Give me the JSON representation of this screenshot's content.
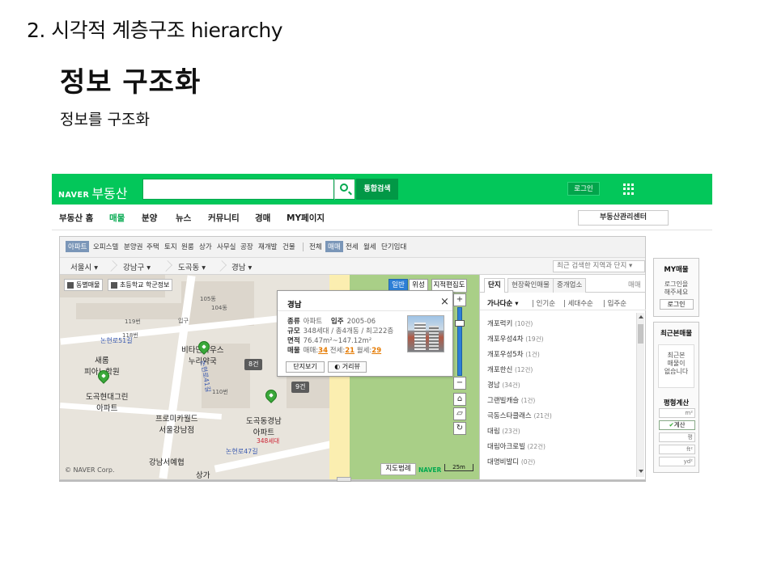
{
  "slide": {
    "heading": "2. 시각적 계층구조 hierarchy",
    "title": "정보 구조화",
    "subtitle": "정보를 구조화"
  },
  "colors": {
    "brand": "#03c75a",
    "accent_blue": "#2d7fd6",
    "highlight_orange": "#e57a00"
  },
  "topbar": {
    "logo_brand": "NAVER",
    "logo_service": "부동산",
    "search_placeholder": "",
    "search_icon": "search-icon",
    "unified_search": "통합검색",
    "login": "로그인",
    "apps_icon": "grid-icon"
  },
  "nav": {
    "items": [
      "부동산 홈",
      "매물",
      "분양",
      "뉴스",
      "커뮤니티",
      "경매",
      "MY페이지"
    ],
    "active": "매물",
    "management": "부동산관리센터"
  },
  "filters": {
    "types": [
      "아파트",
      "오피스텔",
      "분양권",
      "주택",
      "토지",
      "원룸",
      "상가",
      "사무실",
      "공장",
      "재개발",
      "건물"
    ],
    "deals": [
      "전체",
      "매매",
      "전세",
      "월세",
      "단기임대"
    ],
    "active_type": "아파트",
    "active_deal": "매매"
  },
  "location": {
    "crumbs": [
      "서울시",
      "강남구",
      "도곡동",
      "경남"
    ],
    "recent_placeholder": "최근 검색한 지역과 단지"
  },
  "map": {
    "options": [
      "동별매물",
      "초등학교 학군정보"
    ],
    "modes": [
      "일반",
      "위성",
      "지적편집도"
    ],
    "active_mode": "일반",
    "labels": {
      "school": "새롬\n피아노학원",
      "apt1": "도곡현대그린\n아파트",
      "apt2": "도곡동경남\n아파트",
      "pharmacy": "비타민하우스\n누리약국",
      "world": "프로미카월드\n서울강남점",
      "seohoe": "강남서예협",
      "store": "상가",
      "road1": "논현로51길",
      "road2": "논현로47길",
      "road3": "논현로41길",
      "entrance": "입구",
      "unit_count": "348세대",
      "n105": "105동",
      "n104": "104동",
      "n119": "119번",
      "n118": "118번",
      "n110": "110번"
    },
    "badges": [
      "8건",
      "9건"
    ],
    "legend": "지도범례",
    "naver_mark": "NAVER",
    "scale": "25m",
    "copyright": "© NAVER Corp."
  },
  "popup": {
    "title": "경남",
    "close": "×",
    "type_label": "종류",
    "type_value": "아파트",
    "move_in_label": "입주",
    "move_in_value": "2005-06",
    "scale_label": "규모",
    "scale_value": "348세대 / 총4개동 / 최고22층",
    "area_label": "면적",
    "area_value": "76.47m²~147.12m²",
    "listing_label": "매물",
    "sale_label": "매매:",
    "sale_value": "34",
    "jeonse_label": "전세:",
    "jeonse_value": "21",
    "monthly_label": "월세:",
    "monthly_value": "29",
    "btn_detail": "단지보기",
    "btn_street": "거리뷰"
  },
  "side": {
    "tabs": [
      "단지",
      "현장확인매물",
      "중개업소"
    ],
    "deal_label": "매매",
    "sorts": [
      "가나다순",
      "인기순",
      "세대수순",
      "입주순"
    ],
    "complexes": [
      {
        "name": "개포럭키",
        "count": "(10건)"
      },
      {
        "name": "개포우성4차",
        "count": "(19건)"
      },
      {
        "name": "개포우성5차",
        "count": "(1건)"
      },
      {
        "name": "개포한신",
        "count": "(12건)"
      },
      {
        "name": "경남",
        "count": "(34건)"
      },
      {
        "name": "그랜빌캐슬",
        "count": "(1건)"
      },
      {
        "name": "극동스타클래스",
        "count": "(21건)"
      },
      {
        "name": "대림",
        "count": "(23건)"
      },
      {
        "name": "대림아크로빌",
        "count": "(22건)"
      },
      {
        "name": "대명비발디",
        "count": "(0건)"
      }
    ]
  },
  "right": {
    "my_title": "MY매물",
    "my_text": "로그인을\n해주세요",
    "my_btn": "로그인",
    "recent_title": "최근본매물",
    "recent_text": "최근본\n매물이\n없습니다",
    "calc_title": "평형계산",
    "unit_m2": "m²",
    "calc_btn": "계산",
    "unit_py": "평",
    "unit_ft": "ft²",
    "unit_yd": "yd²"
  }
}
